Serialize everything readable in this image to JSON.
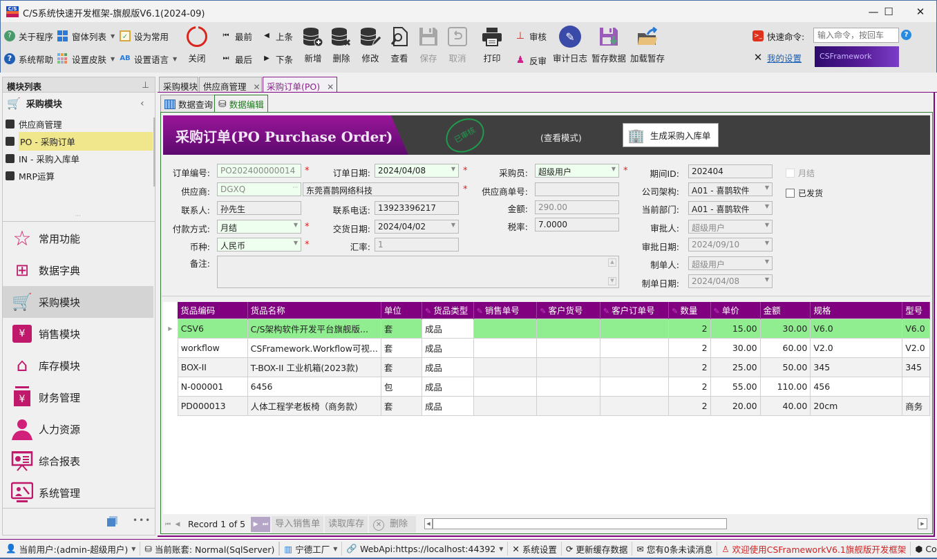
{
  "window": {
    "title": "C/S系统快速开发框架-旗舰版V6.1(2024-09)",
    "logo_text": "C/S",
    "minimize": "—",
    "maximize": "☐",
    "close": "✕"
  },
  "ribbon": {
    "small_buttons": [
      {
        "label": "关于程序",
        "icon": "about-icon"
      },
      {
        "label": "窗体列表",
        "icon": "windows-icon",
        "dropdown": true
      },
      {
        "label": "设为常用",
        "icon": "clipboard-check-icon"
      },
      {
        "label": "系统帮助",
        "icon": "help-icon"
      },
      {
        "label": "设置皮肤",
        "icon": "skin-palette-icon",
        "dropdown": true
      },
      {
        "label": "设置语言",
        "icon": "language-icon",
        "dropdown": true
      }
    ],
    "close_label": "关闭",
    "nav": {
      "first": "最前",
      "prev": "上条",
      "last": "最后",
      "next": "下条"
    },
    "big_buttons": [
      {
        "label": "新增",
        "icon": "db-add-icon",
        "enabled": true
      },
      {
        "label": "删除",
        "icon": "db-delete-icon",
        "enabled": true
      },
      {
        "label": "修改",
        "icon": "db-edit-icon",
        "enabled": true
      },
      {
        "label": "查看",
        "icon": "view-doc-icon",
        "enabled": true
      },
      {
        "label": "保存",
        "icon": "save-icon",
        "enabled": false
      },
      {
        "label": "取消",
        "icon": "undo-icon",
        "enabled": false
      },
      {
        "label": "打印",
        "icon": "printer-icon",
        "enabled": true
      }
    ],
    "approve_label": "审核",
    "unapprove_label": "反审",
    "audit_log_label": "审计日志",
    "temp_save_label": "暂存数据",
    "load_temp_label": "加载暂存",
    "quick_command_label": "快速命令:",
    "quick_command_placeholder": "输入命令，按回车",
    "my_settings_label": "我的设置",
    "banner_text": "CSFramework"
  },
  "left_panel": {
    "header": "模块列表",
    "pin": "ꟸ",
    "current_module": "采购模块",
    "sub_items": [
      {
        "label": "供应商管理",
        "selected": false
      },
      {
        "label": "PO - 采购订单",
        "selected": true
      },
      {
        "label": "IN - 采购入库单",
        "selected": false
      },
      {
        "label": "MRP运算",
        "selected": false
      }
    ],
    "modules": [
      {
        "label": "常用功能",
        "icon": "star-icon",
        "active": false
      },
      {
        "label": "数据字典",
        "icon": "dictionary-icon",
        "active": false
      },
      {
        "label": "采购模块",
        "icon": "cart-icon",
        "active": true
      },
      {
        "label": "销售模块",
        "icon": "shopping-bag-yen-icon",
        "active": false
      },
      {
        "label": "库存模块",
        "icon": "warehouse-icon",
        "active": false
      },
      {
        "label": "财务管理",
        "icon": "yen-box-icon",
        "active": false
      },
      {
        "label": "人力资源",
        "icon": "person-icon",
        "active": false
      },
      {
        "label": "综合报表",
        "icon": "presentation-icon",
        "active": false
      },
      {
        "label": "系统管理",
        "icon": "admin-monitor-icon",
        "active": false
      }
    ],
    "more": "•••"
  },
  "tabs": [
    {
      "label": "采购模块",
      "closable": false,
      "active": false
    },
    {
      "label": "供应商管理",
      "closable": true,
      "active": false
    },
    {
      "label": "采购订单(PO)",
      "closable": true,
      "active": true
    }
  ],
  "sub_tabs": [
    {
      "label": "数据查询",
      "active": false
    },
    {
      "label": "数据编辑",
      "active": true
    }
  ],
  "header": {
    "title": "采购订单(PO Purchase Order)",
    "stamp": "已审核",
    "mode": "(查看模式)",
    "generate_button": "生成采购入库单"
  },
  "form": {
    "order_no": {
      "label": "订单编号:",
      "value": "PO202400000014"
    },
    "order_date": {
      "label": "订单日期:",
      "value": "2024/04/08"
    },
    "buyer": {
      "label": "采购员:",
      "value": "超级用户"
    },
    "period_id": {
      "label": "期间ID:",
      "value": "202404"
    },
    "monthly_settle": {
      "label": "月结",
      "checked": false
    },
    "supplier": {
      "label": "供应商:",
      "code": "DGXQ",
      "name": "东莞喜鹊网络科技"
    },
    "supplier_order_no": {
      "label": "供应商单号:",
      "value": ""
    },
    "company": {
      "label": "公司架构:",
      "value": "A01 - 喜鹊软件"
    },
    "shipped": {
      "label": "已发货",
      "checked": false
    },
    "contact": {
      "label": "联系人:",
      "value": "孙先生"
    },
    "phone": {
      "label": "联系电话:",
      "value": "13923396217"
    },
    "amount": {
      "label": "金额:",
      "value": "290.00"
    },
    "department": {
      "label": "当前部门:",
      "value": "A01 - 喜鹊软件"
    },
    "payment": {
      "label": "付款方式:",
      "value": "月结"
    },
    "delivery_date": {
      "label": "交货日期:",
      "value": "2024/04/02"
    },
    "tax_rate": {
      "label": "税率:",
      "value": "7.0000"
    },
    "approver": {
      "label": "审批人:",
      "value": "超级用户"
    },
    "currency": {
      "label": "币种:",
      "value": "人民币"
    },
    "exchange_rate": {
      "label": "汇率:",
      "value": "1"
    },
    "approve_date": {
      "label": "审批日期:",
      "value": "2024/09/10"
    },
    "remark": {
      "label": "备注:",
      "value": ""
    },
    "creator": {
      "label": "制单人:",
      "value": "超级用户"
    },
    "create_date": {
      "label": "制单日期:",
      "value": "2024/04/08"
    },
    "required_mark": "*"
  },
  "grid": {
    "columns": [
      {
        "label": "货品编码",
        "editable": false
      },
      {
        "label": "货品名称",
        "editable": false
      },
      {
        "label": "单位",
        "editable": false
      },
      {
        "label": "货品类型",
        "editable": true
      },
      {
        "label": "销售单号",
        "editable": true
      },
      {
        "label": "客户货号",
        "editable": true
      },
      {
        "label": "客户订单号",
        "editable": true
      },
      {
        "label": "数量",
        "editable": true
      },
      {
        "label": "单价",
        "editable": true
      },
      {
        "label": "金额",
        "editable": false
      },
      {
        "label": "规格",
        "editable": false
      },
      {
        "label": "型号",
        "editable": false
      }
    ],
    "rows": [
      [
        "CSV6",
        "C/S架构软件开发平台旗舰版...",
        "套",
        "成品",
        "",
        "",
        "",
        "2",
        "15.00",
        "30.00",
        "V6.0",
        "V6.0"
      ],
      [
        "workflow",
        "CSFramework.Workflow可视...",
        "套",
        "成品",
        "",
        "",
        "",
        "2",
        "30.00",
        "60.00",
        "V2.0",
        "V2.0"
      ],
      [
        "BOX-II",
        "T-BOX-II 工业机箱(2023款)",
        "套",
        "成品",
        "",
        "",
        "",
        "2",
        "25.00",
        "50.00",
        "345",
        "345"
      ],
      [
        "N-000001",
        "6456",
        "包",
        "成品",
        "",
        "",
        "",
        "2",
        "55.00",
        "110.00",
        "456",
        ""
      ],
      [
        "PD000013",
        "人体工程学老板椅（商务款）",
        "套",
        "成品",
        "",
        "",
        "",
        "2",
        "20.00",
        "40.00",
        "20cm",
        "商务"
      ]
    ],
    "selected_row": 0,
    "edit_icon": "✎"
  },
  "navigator": {
    "record_text": "Record 1 of 5",
    "import_sales": "导入销售单",
    "read_stock": "读取库存",
    "delete": "删除"
  },
  "statusbar": {
    "user": "当前用户:(admin-超级用户)",
    "account": "当前账套: Normal(SqlServer)",
    "factory": "宁德工厂",
    "webapi": "WebApi:https://localhost:44392",
    "settings": "系统设置",
    "refresh_cache": "更新缓存数据",
    "messages": "您有0条未读消息",
    "welcome": "欢迎使用CSFrameworkV6.1旗舰版开发框架",
    "copyright": "Copy"
  },
  "colors": {
    "accent_purple": "#800080",
    "selected_row": "#90ee90",
    "nav_selected": "#f0e68c",
    "stamp_green": "#1f9b4c",
    "required_red": "#e02020"
  }
}
